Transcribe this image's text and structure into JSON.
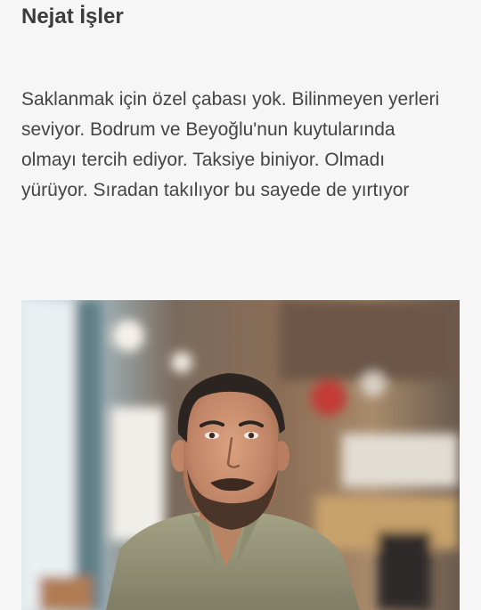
{
  "article": {
    "title": "Nejat İşler",
    "paragraph": "Saklanmak için özel çabası yok. Bilinmeyen yerleri seviyor. Bodrum ve Beyoğlu'nun kuytularında olmayı tercih ediyor. Taksiye biniyor. Olmadı yürüyor. Sıradan takılıyor bu sayede de yırtıyor"
  },
  "photo": {
    "subject": "portrait-photo"
  }
}
